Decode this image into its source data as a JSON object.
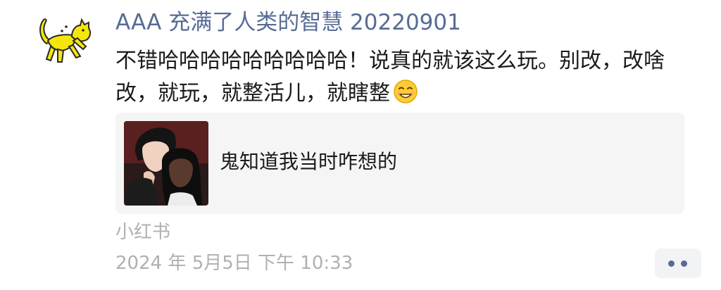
{
  "post": {
    "username": "AAA 充满了人类的智慧 20220901",
    "text": "不错哈哈哈哈哈哈哈哈哈！说真的就该这么玩。别改，改啥改，就玩，就整活儿，就瞎整",
    "emoji_icon": "grinning-squint-face-icon",
    "link_card": {
      "title": "鬼知道我当时咋想的",
      "thumbnail": "game-characters-thumbnail"
    },
    "source": "小红书",
    "timestamp": "2024 年 5月5日 下午 10:33"
  },
  "colors": {
    "username": "#576b95",
    "meta_text": "#b0b0b0",
    "card_bg": "#f5f5f5",
    "avatar_cat": "#f5e60a"
  }
}
